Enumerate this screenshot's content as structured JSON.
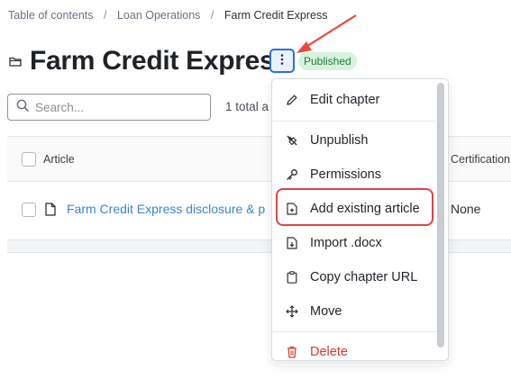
{
  "breadcrumb": {
    "items": [
      "Table of contents",
      "Loan Operations"
    ],
    "current": "Farm Credit Express",
    "separator": "/"
  },
  "page": {
    "title": "Farm Credit Express",
    "status_badge": "Published",
    "kebab_icon": "vertical-dots-icon"
  },
  "search": {
    "placeholder": "Search...",
    "value": "",
    "icon": "search-icon"
  },
  "results": {
    "total_text": "1 total a"
  },
  "table": {
    "columns": [
      "Article",
      "Certification"
    ],
    "rows": [
      {
        "article": "Farm Credit Express disclosure & p",
        "certification": "None",
        "icon": "document-icon"
      }
    ]
  },
  "menu": {
    "items": [
      {
        "label": "Edit chapter",
        "icon": "pencil-icon",
        "danger": false
      },
      {
        "label": "Unpublish",
        "icon": "unpublish-icon",
        "danger": false
      },
      {
        "label": "Permissions",
        "icon": "key-icon",
        "danger": false
      },
      {
        "label": "Add existing article",
        "icon": "add-document-icon",
        "danger": false,
        "highlighted": true
      },
      {
        "label": "Import .docx",
        "icon": "import-document-icon",
        "danger": false
      },
      {
        "label": "Copy chapter URL",
        "icon": "clipboard-icon",
        "danger": false
      },
      {
        "label": "Move",
        "icon": "move-icon",
        "danger": false
      },
      {
        "label": "Delete",
        "icon": "trash-icon",
        "danger": true
      }
    ]
  },
  "colors": {
    "accent": "#2f6fd6",
    "link": "#3a87c9",
    "badge_bg": "#d8f3dc",
    "badge_text": "#1f7a3a",
    "annotation_red": "#e04444",
    "danger": "#d63a2f"
  }
}
